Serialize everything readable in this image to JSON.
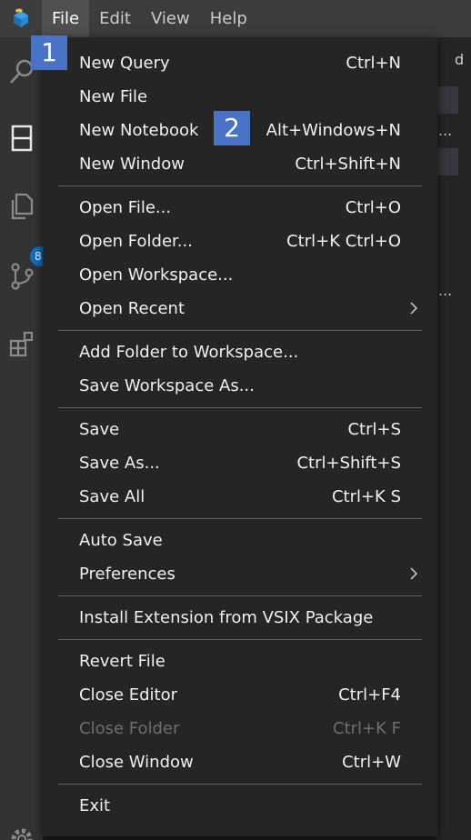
{
  "menubar": {
    "items": [
      {
        "label": "File",
        "active": true
      },
      {
        "label": "Edit",
        "active": false
      },
      {
        "label": "View",
        "active": false
      },
      {
        "label": "Help",
        "active": false
      }
    ]
  },
  "activitybar": {
    "icons": [
      "search-icon",
      "notebook-icon",
      "files-icon",
      "source-control-icon",
      "extensions-icon",
      "settings-gear-icon"
    ],
    "badge": "8"
  },
  "background": {
    "fragment_top": "d",
    "ellipsis_1": "...",
    "ellipsis_2": "..."
  },
  "file_menu": {
    "groups": [
      [
        {
          "label": "New Query",
          "shortcut": "Ctrl+N"
        },
        {
          "label": "New File",
          "shortcut": ""
        },
        {
          "label": "New Notebook",
          "shortcut": "Alt+Windows+N"
        },
        {
          "label": "New Window",
          "shortcut": "Ctrl+Shift+N"
        }
      ],
      [
        {
          "label": "Open File...",
          "shortcut": "Ctrl+O"
        },
        {
          "label": "Open Folder...",
          "shortcut": "Ctrl+K Ctrl+O"
        },
        {
          "label": "Open Workspace...",
          "shortcut": ""
        },
        {
          "label": "Open Recent",
          "shortcut": "",
          "submenu": true
        }
      ],
      [
        {
          "label": "Add Folder to Workspace...",
          "shortcut": ""
        },
        {
          "label": "Save Workspace As...",
          "shortcut": ""
        }
      ],
      [
        {
          "label": "Save",
          "shortcut": "Ctrl+S"
        },
        {
          "label": "Save As...",
          "shortcut": "Ctrl+Shift+S"
        },
        {
          "label": "Save All",
          "shortcut": "Ctrl+K S"
        }
      ],
      [
        {
          "label": "Auto Save",
          "shortcut": ""
        },
        {
          "label": "Preferences",
          "shortcut": "",
          "submenu": true
        }
      ],
      [
        {
          "label": "Install Extension from VSIX Package",
          "shortcut": ""
        }
      ],
      [
        {
          "label": "Revert File",
          "shortcut": ""
        },
        {
          "label": "Close Editor",
          "shortcut": "Ctrl+F4"
        },
        {
          "label": "Close Folder",
          "shortcut": "Ctrl+K F",
          "disabled": true
        },
        {
          "label": "Close Window",
          "shortcut": "Ctrl+W"
        }
      ],
      [
        {
          "label": "Exit",
          "shortcut": ""
        }
      ]
    ]
  },
  "markers": [
    {
      "label": "1"
    },
    {
      "label": "2"
    }
  ],
  "colors": {
    "menubar": "#3c3c3c",
    "menu_bg": "#252526",
    "activity_bar": "#333333",
    "marker": "#4a72c6",
    "badge": "#0e70c0"
  }
}
